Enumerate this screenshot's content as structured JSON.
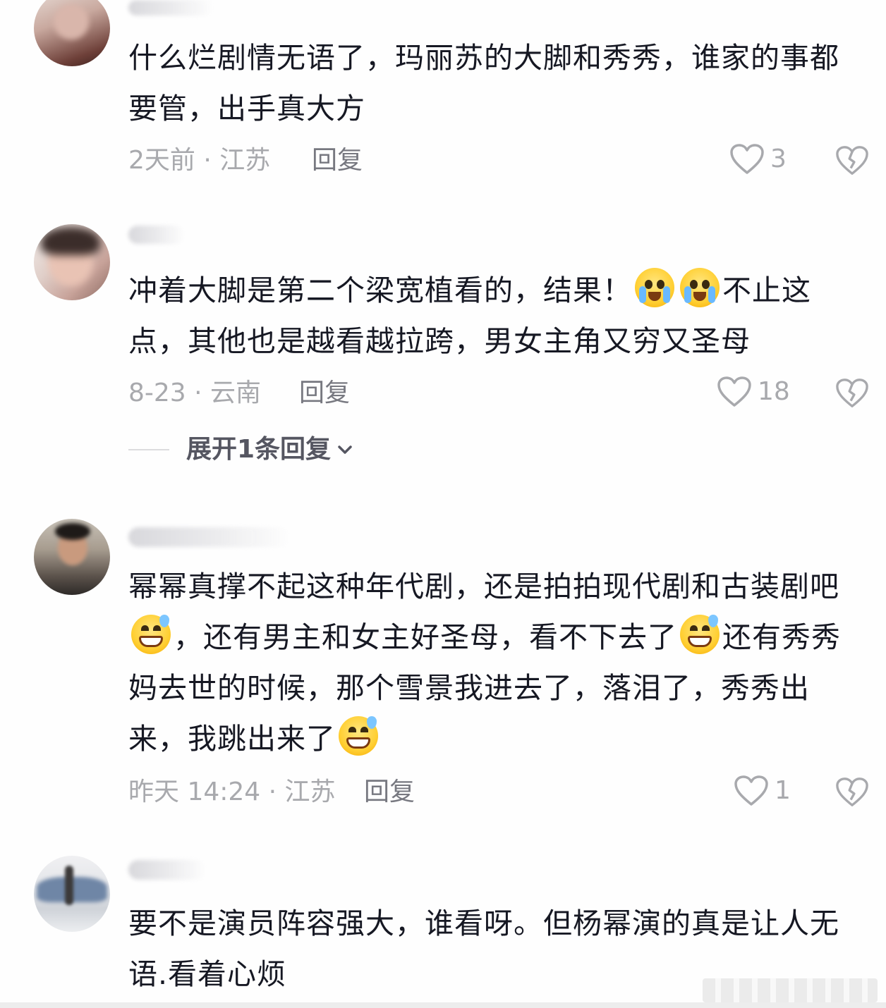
{
  "comments": [
    {
      "text": "什么烂剧情无语了，玛丽苏的大脚和秀秀，谁家的事都要管，出手真大方",
      "meta": "2天前 · 江苏",
      "reply_label": "回复",
      "likes": "3"
    },
    {
      "text_before": "冲着大脚是第二个梁宽植看的，结果！",
      "text_after": "不止这点，其他也是越看越拉跨，男女主角又穷又圣母",
      "meta": "8-23 · 云南",
      "reply_label": "回复",
      "likes": "18",
      "expand_label": "展开1条回复"
    },
    {
      "text_1": "幂幂真撑不起这种年代剧，还是拍拍现代剧和古装剧吧",
      "text_2": "，还有男主和女主好圣母，看不下去了",
      "text_3": "还有秀秀妈去世的时候，那个雪景我进去了，落泪了，秀秀出来，我跳出来了",
      "meta": "昨天 14:24 · 江苏",
      "reply_label": "回复",
      "likes": "1"
    },
    {
      "text": "要不是演员阵容强大，谁看呀。但杨幂演的真是让人无语.看着心烦"
    }
  ],
  "icons": {
    "like": "heart-outline-icon",
    "dislike": "broken-heart-icon",
    "expand": "chevron-down-icon",
    "emoji_1": "crying-face-emoji",
    "emoji_2": "grinning-sweat-emoji"
  },
  "colors": {
    "text": "#161823",
    "meta": "#a8a9ad",
    "reply": "#777880",
    "icon": "#a8a9ad"
  }
}
